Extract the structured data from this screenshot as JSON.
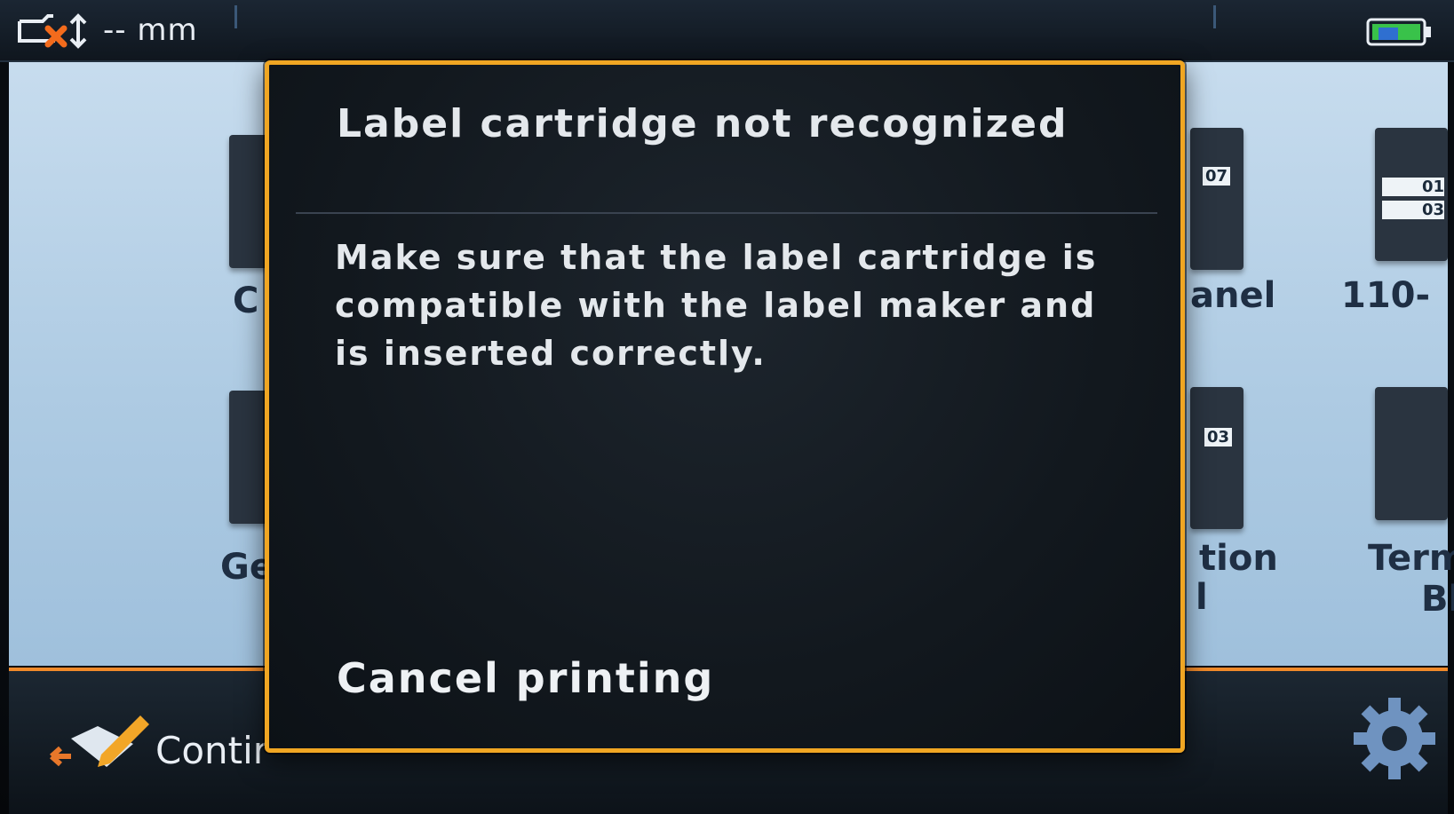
{
  "status_bar": {
    "label_size": "-- mm",
    "media_icon": "label-cartridge-error-icon",
    "battery_icon": "battery-charging-icon"
  },
  "background": {
    "tiles_right_top": [
      "anel",
      "110-"
    ],
    "tiles_right_bottom": [
      "tion",
      "Term",
      "Bl"
    ],
    "tiles_left": [
      "C",
      "Ge"
    ],
    "right_bottom_extra": "l",
    "tile_badges": [
      "07",
      "01",
      "03",
      "03"
    ],
    "bottom_bar": {
      "continue_label": "Contir",
      "edit_icon": "edit-label-icon",
      "settings_icon": "gear-icon",
      "accent_color": "#f08a2a"
    }
  },
  "dialog": {
    "title": "Label cartridge not recognized",
    "message": "Make sure that the label cartridge is compatible with the label maker and is inserted correctly.",
    "cancel_label": "Cancel printing",
    "border_color": "#f0a623"
  }
}
